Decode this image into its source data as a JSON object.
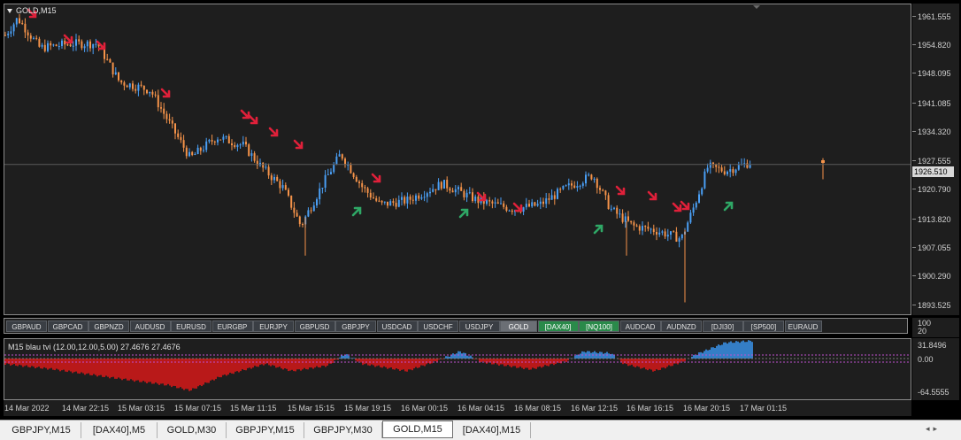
{
  "chart": {
    "title": "GOLD,M15",
    "current_price": "1926.510",
    "price_labels": [
      "1961.555",
      "1954.820",
      "1948.095",
      "1941.085",
      "1934.320",
      "1927.555",
      "1920.790",
      "1913.820",
      "1907.055",
      "1900.290",
      "1893.525"
    ],
    "price_axis": {
      "top": 1963.2,
      "bottom": 1891.8,
      "current": 1926.51
    },
    "colors": {
      "bull": "#4a9ff5",
      "bear": "#f5934a",
      "signal_down": "#e0203a",
      "signal_up": "#2fa866",
      "hist_pos": "#3a96f0",
      "hist_neg": "#e01818",
      "bg": "#1e1e1e"
    }
  },
  "symbol_buttons": [
    {
      "label": "GBPAUD",
      "state": "normal"
    },
    {
      "label": "GBPCAD",
      "state": "normal"
    },
    {
      "label": "GBPNZD",
      "state": "normal"
    },
    {
      "label": "AUDUSD",
      "state": "normal"
    },
    {
      "label": "EURUSD",
      "state": "normal"
    },
    {
      "label": "EURGBP",
      "state": "normal"
    },
    {
      "label": "EURJPY",
      "state": "normal"
    },
    {
      "label": "GBPUSD",
      "state": "normal"
    },
    {
      "label": "GBPJPY",
      "state": "normal"
    },
    {
      "label": "USDCAD",
      "state": "normal"
    },
    {
      "label": "USDCHF",
      "state": "normal"
    },
    {
      "label": "USDJPY",
      "state": "normal"
    },
    {
      "label": "GOLD",
      "state": "selected"
    },
    {
      "label": "[DAX40]",
      "state": "green"
    },
    {
      "label": "[NQ100]",
      "state": "green"
    },
    {
      "label": "AUDCAD",
      "state": "normal"
    },
    {
      "label": "AUDNZD",
      "state": "normal"
    },
    {
      "label": "[DJI30]",
      "state": "normal"
    },
    {
      "label": "[SP500]",
      "state": "normal"
    },
    {
      "label": "EURAUD",
      "state": "normal"
    }
  ],
  "indicator": {
    "title": "M15  blau tvi (12.00,12.00,5.00)  27.4676 27.4676",
    "scale_top": [
      "100",
      "20"
    ],
    "labels": [
      "31.8496",
      "0.00",
      "-64.5555"
    ]
  },
  "time_labels": [
    "14 Mar 2022",
    "14 Mar 22:15",
    "15 Mar 03:15",
    "15 Mar 07:15",
    "15 Mar 11:15",
    "15 Mar 15:15",
    "15 Mar 19:15",
    "16 Mar 00:15",
    "16 Mar 04:15",
    "16 Mar 08:15",
    "16 Mar 12:15",
    "16 Mar 16:15",
    "16 Mar 20:15",
    "17 Mar 01:15"
  ],
  "tabs": [
    {
      "label": "GBPJPY,M15",
      "active": false
    },
    {
      "label": "[DAX40],M5",
      "active": false
    },
    {
      "label": "GOLD,M30",
      "active": false
    },
    {
      "label": "GBPJPY,M15",
      "active": false
    },
    {
      "label": "GBPJPY,M30",
      "active": false
    },
    {
      "label": "GOLD,M15",
      "active": true
    },
    {
      "label": "[DAX40],M15",
      "active": false
    }
  ]
}
